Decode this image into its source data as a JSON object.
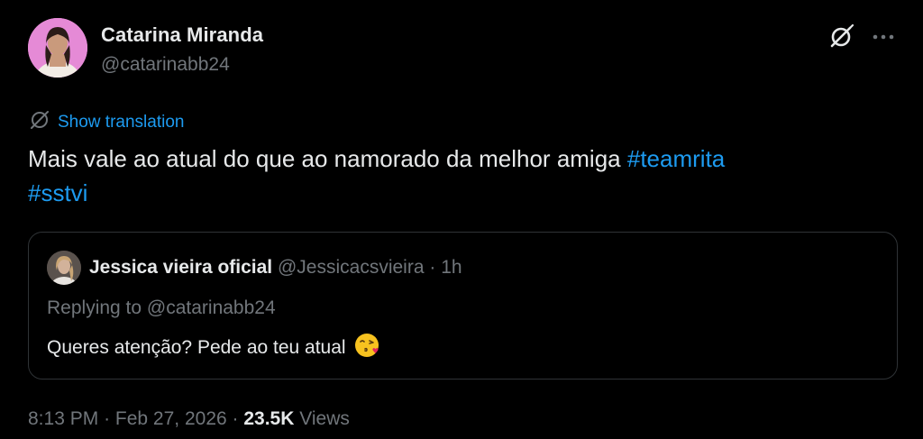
{
  "author": {
    "name": "Catarina Miranda",
    "handle": "@catarinabb24"
  },
  "actions": {
    "grok_icon": "grok-icon",
    "more_icon": "more-options-icon"
  },
  "translation": {
    "label": "Show translation",
    "icon": "globe-translate-icon"
  },
  "tweet": {
    "text": "Mais vale ao atual do que ao namorado da melhor amiga",
    "hashtags": [
      "#teamrita",
      "#sstvi"
    ]
  },
  "quote": {
    "name": "Jessica vieira oficial",
    "handle": "@Jessicacsvieira",
    "separator": "·",
    "time": "1h",
    "replying": "Replying to @catarinabb24",
    "text": "Queres atenção? Pede ao teu atual",
    "emoji": "face-blowing-kiss-emoji"
  },
  "meta": {
    "time": "8:13 PM",
    "separator1": "·",
    "date": "Feb 27, 2026",
    "separator2": "·",
    "views_count": "23.5K",
    "views_label": "Views"
  },
  "colors": {
    "background": "#000000",
    "text": "#e7e9ea",
    "secondary": "#71767b",
    "accent": "#1d9bf0",
    "border": "#2f3336",
    "avatar_bg": "#e58ad6"
  }
}
